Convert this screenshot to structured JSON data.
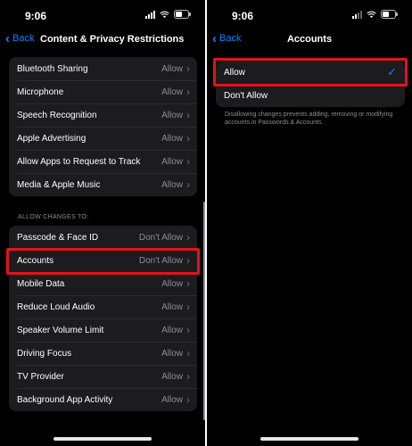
{
  "left": {
    "status_time": "9:06",
    "back_label": "Back",
    "title": "Content & Privacy Restrictions",
    "top_group": [
      {
        "label": "Bluetooth Sharing",
        "value": "Allow"
      },
      {
        "label": "Microphone",
        "value": "Allow"
      },
      {
        "label": "Speech Recognition",
        "value": "Allow"
      },
      {
        "label": "Apple Advertising",
        "value": "Allow"
      },
      {
        "label": "Allow Apps to Request to Track",
        "value": "Allow"
      },
      {
        "label": "Media & Apple Music",
        "value": "Allow"
      }
    ],
    "section_header": "ALLOW CHANGES TO:",
    "changes_group": [
      {
        "label": "Passcode & Face ID",
        "value": "Don't Allow"
      },
      {
        "label": "Accounts",
        "value": "Don't Allow"
      },
      {
        "label": "Mobile Data",
        "value": "Allow"
      },
      {
        "label": "Reduce Loud Audio",
        "value": "Allow"
      },
      {
        "label": "Speaker Volume Limit",
        "value": "Allow"
      },
      {
        "label": "Driving Focus",
        "value": "Allow"
      },
      {
        "label": "TV Provider",
        "value": "Allow"
      },
      {
        "label": "Background App Activity",
        "value": "Allow"
      }
    ]
  },
  "right": {
    "status_time": "9:06",
    "back_label": "Back",
    "title": "Accounts",
    "options": [
      {
        "label": "Allow",
        "selected": true
      },
      {
        "label": "Don't Allow",
        "selected": false
      }
    ],
    "footnote": "Disallowing changes prevents adding, removing or modifying accounts in Passwords & Accounts."
  },
  "colors": {
    "accent": "#0a84ff",
    "highlight": "#e0141e"
  },
  "icons": [
    "signal-icon",
    "wifi-icon",
    "battery-icon",
    "chevron-left-icon",
    "chevron-right-icon",
    "checkmark-icon"
  ]
}
